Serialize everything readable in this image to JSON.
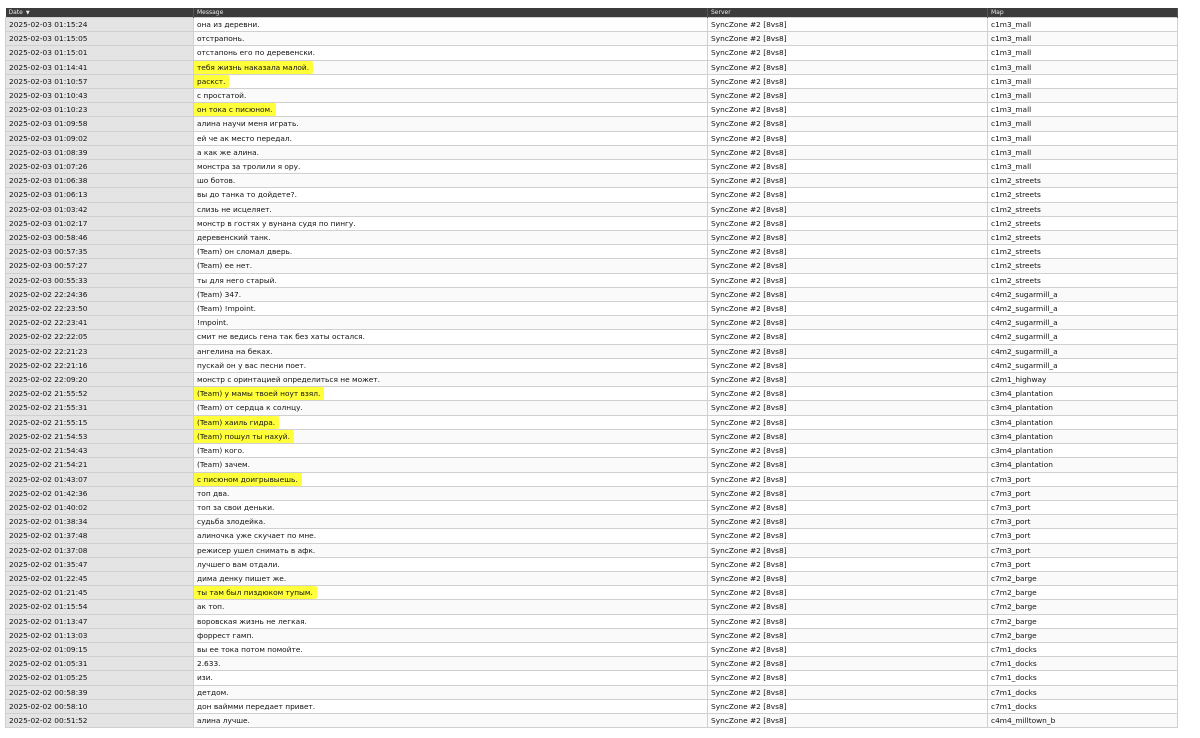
{
  "columns": {
    "date": "Date",
    "message": "Message",
    "server": "Server",
    "map": "Map"
  },
  "sort_indicator": "▼",
  "colors": {
    "header_bg": "#3b3b3b",
    "date_cell_bg": "#e4e4e4",
    "highlight": "#ffff3a"
  },
  "rows": [
    {
      "date": "2025-02-03 01:15:24",
      "message": "она из деревни.",
      "server": "SyncZone #2 [8vs8]",
      "map": "c1m3_mall",
      "highlight": ""
    },
    {
      "date": "2025-02-03 01:15:05",
      "message": "отстрапонь.",
      "server": "SyncZone #2 [8vs8]",
      "map": "c1m3_mall",
      "highlight": ""
    },
    {
      "date": "2025-02-03 01:15:01",
      "message": "отстапонь его по деревенски.",
      "server": "SyncZone #2 [8vs8]",
      "map": "c1m3_mall",
      "highlight": ""
    },
    {
      "date": "2025-02-03 01:14:41",
      "message": "тебя жизнь наказала малой.",
      "server": "SyncZone #2 [8vs8]",
      "map": "c1m3_mall",
      "highlight": "full"
    },
    {
      "date": "2025-02-03 01:10:57",
      "message": "раскст.",
      "server": "SyncZone #2 [8vs8]",
      "map": "c1m3_mall",
      "highlight": "full"
    },
    {
      "date": "2025-02-03 01:10:43",
      "message": "с простатой.",
      "server": "SyncZone #2 [8vs8]",
      "map": "c1m3_mall",
      "highlight": ""
    },
    {
      "date": "2025-02-03 01:10:23",
      "message": "он тока с писюном.",
      "server": "SyncZone #2 [8vs8]",
      "map": "c1m3_mall",
      "highlight": "full"
    },
    {
      "date": "2025-02-03 01:09:58",
      "message": "алина научи меня играть.",
      "server": "SyncZone #2 [8vs8]",
      "map": "c1m3_mall",
      "highlight": ""
    },
    {
      "date": "2025-02-03 01:09:02",
      "message": "ей че ак место передал.",
      "server": "SyncZone #2 [8vs8]",
      "map": "c1m3_mall",
      "highlight": ""
    },
    {
      "date": "2025-02-03 01:08:39",
      "message": "а как же алина.",
      "server": "SyncZone #2 [8vs8]",
      "map": "c1m3_mall",
      "highlight": ""
    },
    {
      "date": "2025-02-03 01:07:26",
      "message": "монстра за тролили я ору.",
      "server": "SyncZone #2 [8vs8]",
      "map": "c1m3_mall",
      "highlight": ""
    },
    {
      "date": "2025-02-03 01:06:38",
      "message": "шо ботов.",
      "server": "SyncZone #2 [8vs8]",
      "map": "c1m2_streets",
      "highlight": ""
    },
    {
      "date": "2025-02-03 01:06:13",
      "message": "вы до танка то дойдете?.",
      "server": "SyncZone #2 [8vs8]",
      "map": "c1m2_streets",
      "highlight": ""
    },
    {
      "date": "2025-02-03 01:03:42",
      "message": "слизь не исцеляет.",
      "server": "SyncZone #2 [8vs8]",
      "map": "c1m2_streets",
      "highlight": ""
    },
    {
      "date": "2025-02-03 01:02:17",
      "message": "монстр в гостях у вунана судя по пингу.",
      "server": "SyncZone #2 [8vs8]",
      "map": "c1m2_streets",
      "highlight": ""
    },
    {
      "date": "2025-02-03 00:58:46",
      "message": "деревенский танк.",
      "server": "SyncZone #2 [8vs8]",
      "map": "c1m2_streets",
      "highlight": ""
    },
    {
      "date": "2025-02-03 00:57:35",
      "message": "(Team) он сломал дверь.",
      "server": "SyncZone #2 [8vs8]",
      "map": "c1m2_streets",
      "highlight": ""
    },
    {
      "date": "2025-02-03 00:57:27",
      "message": "(Team) ее нет.",
      "server": "SyncZone #2 [8vs8]",
      "map": "c1m2_streets",
      "highlight": ""
    },
    {
      "date": "2025-02-03 00:55:33",
      "message": "ты для него старый.",
      "server": "SyncZone #2 [8vs8]",
      "map": "c1m2_streets",
      "highlight": ""
    },
    {
      "date": "2025-02-02 22:24:36",
      "message": "(Team) 347.",
      "server": "SyncZone #2 [8vs8]",
      "map": "c4m2_sugarmill_a",
      "highlight": ""
    },
    {
      "date": "2025-02-02 22:23:50",
      "message": "(Team) !mpoint.",
      "server": "SyncZone #2 [8vs8]",
      "map": "c4m2_sugarmill_a",
      "highlight": ""
    },
    {
      "date": "2025-02-02 22:23:41",
      "message": "!mpoint.",
      "server": "SyncZone #2 [8vs8]",
      "map": "c4m2_sugarmill_a",
      "highlight": ""
    },
    {
      "date": "2025-02-02 22:22:05",
      "message": "смит не ведись гена так без хаты остался.",
      "server": "SyncZone #2 [8vs8]",
      "map": "c4m2_sugarmill_a",
      "highlight": ""
    },
    {
      "date": "2025-02-02 22:21:23",
      "message": "ангелина на беках.",
      "server": "SyncZone #2 [8vs8]",
      "map": "c4m2_sugarmill_a",
      "highlight": ""
    },
    {
      "date": "2025-02-02 22:21:16",
      "message": "пускай он у вас песни поет.",
      "server": "SyncZone #2 [8vs8]",
      "map": "c4m2_sugarmill_a",
      "highlight": ""
    },
    {
      "date": "2025-02-02 22:09:20",
      "message": "монстр с оринтацией определиться не может.",
      "server": "SyncZone #2 [8vs8]",
      "map": "c2m1_highway",
      "highlight": ""
    },
    {
      "date": "2025-02-02 21:55:52",
      "message": "(Team) у мамы твоей ноут взял.",
      "server": "SyncZone #2 [8vs8]",
      "map": "c3m4_plantation",
      "highlight": "full"
    },
    {
      "date": "2025-02-02 21:55:31",
      "message": "(Team) от сердца к солнцу.",
      "server": "SyncZone #2 [8vs8]",
      "map": "c3m4_plantation",
      "highlight": ""
    },
    {
      "date": "2025-02-02 21:55:15",
      "message": "(Team) хаиль гидра.",
      "server": "SyncZone #2 [8vs8]",
      "map": "c3m4_plantation",
      "highlight": "full"
    },
    {
      "date": "2025-02-02 21:54:53",
      "message": "(Team) пошул ты нахуй.",
      "server": "SyncZone #2 [8vs8]",
      "map": "c3m4_plantation",
      "highlight": "full"
    },
    {
      "date": "2025-02-02 21:54:43",
      "message": "(Team) кого.",
      "server": "SyncZone #2 [8vs8]",
      "map": "c3m4_plantation",
      "highlight": ""
    },
    {
      "date": "2025-02-02 21:54:21",
      "message": "(Team) зачем.",
      "server": "SyncZone #2 [8vs8]",
      "map": "c3m4_plantation",
      "highlight": ""
    },
    {
      "date": "2025-02-02 01:43:07",
      "message": "с писюном доигрывыешь.",
      "server": "SyncZone #2 [8vs8]",
      "map": "c7m3_port",
      "highlight": "full"
    },
    {
      "date": "2025-02-02 01:42:36",
      "message": "топ два.",
      "server": "SyncZone #2 [8vs8]",
      "map": "c7m3_port",
      "highlight": ""
    },
    {
      "date": "2025-02-02 01:40:02",
      "message": "топ за свои деньки.",
      "server": "SyncZone #2 [8vs8]",
      "map": "c7m3_port",
      "highlight": ""
    },
    {
      "date": "2025-02-02 01:38:34",
      "message": "судьба злодейка.",
      "server": "SyncZone #2 [8vs8]",
      "map": "c7m3_port",
      "highlight": ""
    },
    {
      "date": "2025-02-02 01:37:48",
      "message": "алиночка уже скучает по мне.",
      "server": "SyncZone #2 [8vs8]",
      "map": "c7m3_port",
      "highlight": ""
    },
    {
      "date": "2025-02-02 01:37:08",
      "message": "режисер ушел снимать в афк.",
      "server": "SyncZone #2 [8vs8]",
      "map": "c7m3_port",
      "highlight": ""
    },
    {
      "date": "2025-02-02 01:35:47",
      "message": "лучшего вам отдали.",
      "server": "SyncZone #2 [8vs8]",
      "map": "c7m3_port",
      "highlight": ""
    },
    {
      "date": "2025-02-02 01:22:45",
      "message": "дима денку пишет же.",
      "server": "SyncZone #2 [8vs8]",
      "map": "c7m2_barge",
      "highlight": ""
    },
    {
      "date": "2025-02-02 01:21:45",
      "message": "ты там был пиздюком тупым.",
      "server": "SyncZone #2 [8vs8]",
      "map": "c7m2_barge",
      "highlight": "full"
    },
    {
      "date": "2025-02-02 01:15:54",
      "message": "ак топ.",
      "server": "SyncZone #2 [8vs8]",
      "map": "c7m2_barge",
      "highlight": ""
    },
    {
      "date": "2025-02-02 01:13:47",
      "message": "воровская жизнь не легкая.",
      "server": "SyncZone #2 [8vs8]",
      "map": "c7m2_barge",
      "highlight": ""
    },
    {
      "date": "2025-02-02 01:13:03",
      "message": "форрест гамп.",
      "server": "SyncZone #2 [8vs8]",
      "map": "c7m2_barge",
      "highlight": ""
    },
    {
      "date": "2025-02-02 01:09:15",
      "message": "вы ее тока потом помойте.",
      "server": "SyncZone #2 [8vs8]",
      "map": "c7m1_docks",
      "highlight": ""
    },
    {
      "date": "2025-02-02 01:05:31",
      "message": "2.633.",
      "server": "SyncZone #2 [8vs8]",
      "map": "c7m1_docks",
      "highlight": ""
    },
    {
      "date": "2025-02-02 01:05:25",
      "message": "изи.",
      "server": "SyncZone #2 [8vs8]",
      "map": "c7m1_docks",
      "highlight": ""
    },
    {
      "date": "2025-02-02 00:58:39",
      "message": "детдом.",
      "server": "SyncZone #2 [8vs8]",
      "map": "c7m1_docks",
      "highlight": ""
    },
    {
      "date": "2025-02-02 00:58:10",
      "message": "дон ваймми передает привет.",
      "server": "SyncZone #2 [8vs8]",
      "map": "c7m1_docks",
      "highlight": ""
    },
    {
      "date": "2025-02-02 00:51:52",
      "message": "алина лучше.",
      "server": "SyncZone #2 [8vs8]",
      "map": "c4m4_milltown_b",
      "highlight": ""
    }
  ]
}
